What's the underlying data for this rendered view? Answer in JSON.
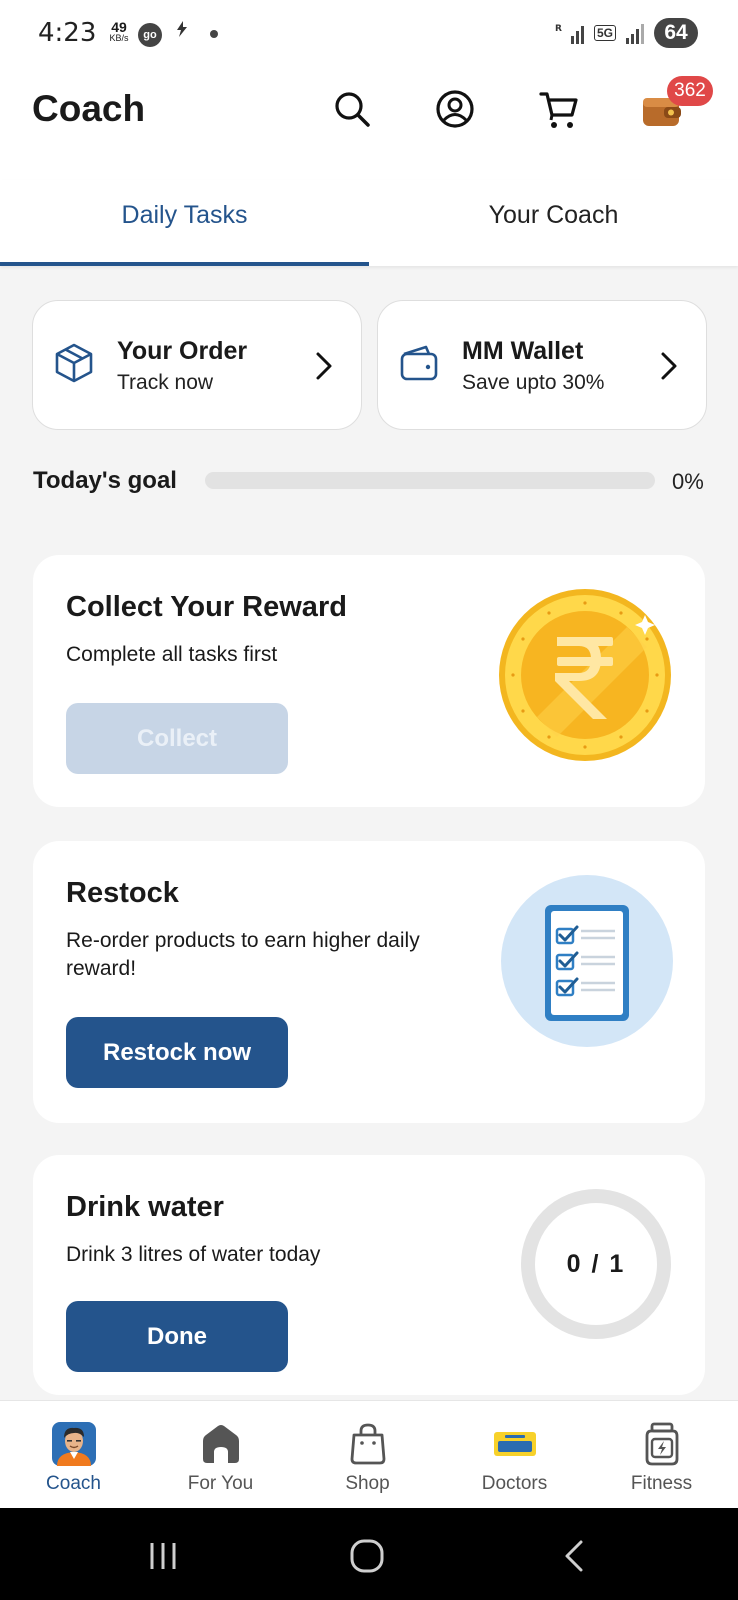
{
  "status_bar": {
    "time": "4:23",
    "net_speed_value": "49",
    "net_speed_unit": "KB/s",
    "go_badge": "go",
    "network_5g": "5G",
    "battery": "64"
  },
  "header": {
    "title": "Coach",
    "wallet_badge_count": "362"
  },
  "tabs": [
    {
      "label": "Daily Tasks",
      "active": true
    },
    {
      "label": "Your Coach",
      "active": false
    }
  ],
  "quick_cards": {
    "order": {
      "title": "Your Order",
      "subtitle": "Track now",
      "icon": "package-icon"
    },
    "wallet": {
      "title": "MM Wallet",
      "subtitle": "Save upto 30%",
      "icon": "wallet-icon"
    }
  },
  "goal": {
    "label": "Today's goal",
    "percent_text": "0%",
    "progress": 0
  },
  "tasks": {
    "reward": {
      "title": "Collect Your Reward",
      "description": "Complete all tasks first",
      "button": "Collect",
      "button_disabled": true,
      "art": "rupee-coin-icon"
    },
    "restock": {
      "title": "Restock",
      "description": "Re-order products to earn higher daily reward!",
      "button": "Restock now",
      "art": "checklist-icon"
    },
    "water": {
      "title": "Drink water",
      "description": "Drink 3 litres of water today",
      "button": "Done",
      "counter": "0 / 1"
    }
  },
  "bottom_nav": [
    {
      "label": "Coach",
      "icon": "coach-avatar-icon",
      "active": true
    },
    {
      "label": "For You",
      "icon": "home-icon",
      "active": false
    },
    {
      "label": "Shop",
      "icon": "shopping-bag-icon",
      "active": false
    },
    {
      "label": "Doctors",
      "icon": "health-pass-icon",
      "active": false
    },
    {
      "label": "Fitness",
      "icon": "supplement-jar-icon",
      "active": false
    }
  ],
  "colors": {
    "accent": "#24548c",
    "badge": "#e04848",
    "disabled_button": "#c7d5e6",
    "background": "#f4f4f4"
  }
}
